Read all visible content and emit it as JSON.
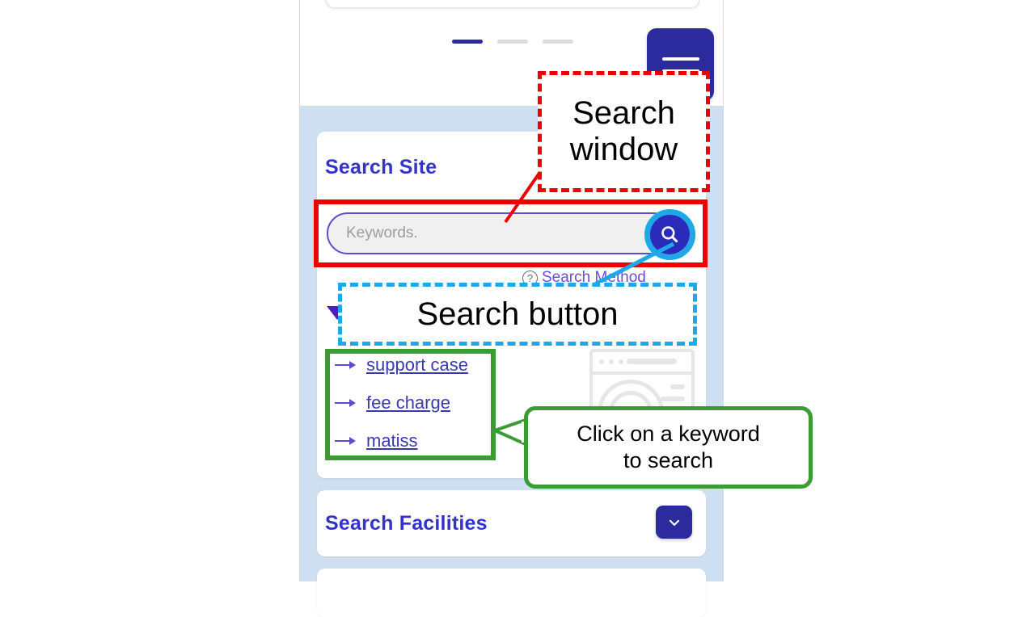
{
  "mobile_page": {
    "carousel": {
      "dots": 3,
      "active_index": 0
    },
    "menu_button": {
      "name": "hamburger-menu",
      "color": "#2b2b9e"
    },
    "background_color": "#cddff0",
    "sections": [
      {
        "title": "Search Site",
        "search": {
          "placeholder": "Keywords.",
          "value": "",
          "button_icon": "magnifier-icon",
          "button_color": "#2b2bbb"
        },
        "help_link": {
          "icon": "question-mark-icon",
          "label": "Search Method"
        },
        "keywords": [
          {
            "label": "support case"
          },
          {
            "label": "fee charge"
          },
          {
            "label": "matiss"
          }
        ]
      },
      {
        "title": "Search Facilities",
        "toggle_icon": "chevron-down-icon"
      }
    ]
  },
  "annotations": {
    "search_window": {
      "lines": [
        "Search",
        "window"
      ],
      "color": "#ee0000",
      "style": "dashed"
    },
    "search_button": {
      "text": "Search button",
      "color": "#1da8e8",
      "style": "dashed"
    },
    "keyword_hint": {
      "lines": [
        "Click on a keyword",
        "to search"
      ],
      "color": "#3d9b35",
      "style": "solid"
    }
  }
}
